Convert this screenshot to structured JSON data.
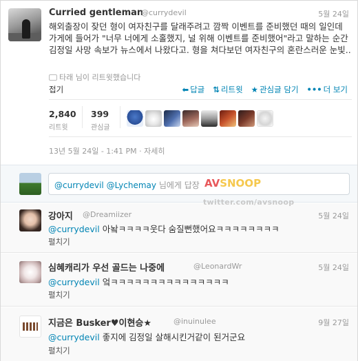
{
  "main_tweet": {
    "name": "Curried gentleman",
    "handle": "@currydevil",
    "date": "5월 24일",
    "text": "해외출장이 잦던 형이 여자친구를 달래주려고 깜짝 이벤트를 준비했던 때의 일인데 가게에 들어가 \"너무 너에게 소홀했지, 널 위해 이벤트를 준비했어\"라고 말하는 순간 김정일 사망 속보가 뉴스에서 나왔다고. 형을 쳐다보던 여자친구의 혼란스러운 눈빛..",
    "retweeted_by": "타래 님이 리트윗했습니다",
    "collapse_label": "접기",
    "actions": {
      "reply": "답글",
      "retweet": "리트윗",
      "favorite": "관심글 담기",
      "more": "더 보기"
    },
    "stats": {
      "retweets": "2,840",
      "retweets_label": "리트윗",
      "favorites": "399",
      "favorites_label": "관심글"
    },
    "timestamp": "13년 5월 24일 - 1:41 PM · 자세히"
  },
  "reply_box": {
    "mention1": "@currydevil",
    "mention2": "@Lychemay",
    "placeholder_tail": "님에게 답장"
  },
  "replies": [
    {
      "name": "강아지",
      "handle": "@Dreamiizer",
      "date": "5월 24일",
      "mention": "@currydevil",
      "text": " 아놬ㅋㅋㅋㅋ웃다 숨질뻔했어요ㅋㅋㅋㅋㅋㅋㅋㅋ",
      "expand": "펼치기"
    },
    {
      "name": "심혜캐리가 우선 골드는 나중에",
      "handle": "@LeonardWr",
      "date": "5월 24일",
      "mention": "@currydevil",
      "text": " 엌ㅋㅋㅋㅋㅋㅋㅋㅋㅋㅋㅋㅋㅋㅋㅋ",
      "expand": "펼치기"
    },
    {
      "name": "지금은 Busker♥이현승★",
      "handle": "@inuinulee",
      "date": "9월 27일",
      "mention": "@currydevil",
      "text": " 좋지에 김정일 살해시킨거같이 된거군요",
      "expand": "펼치기"
    }
  ],
  "watermark": {
    "brand_a": "AV",
    "brand_b": "SNOOP",
    "url": "twitter.com/avsnoop"
  },
  "colors": {
    "link": "#0084b4",
    "muted": "#999999",
    "text": "#333333"
  }
}
